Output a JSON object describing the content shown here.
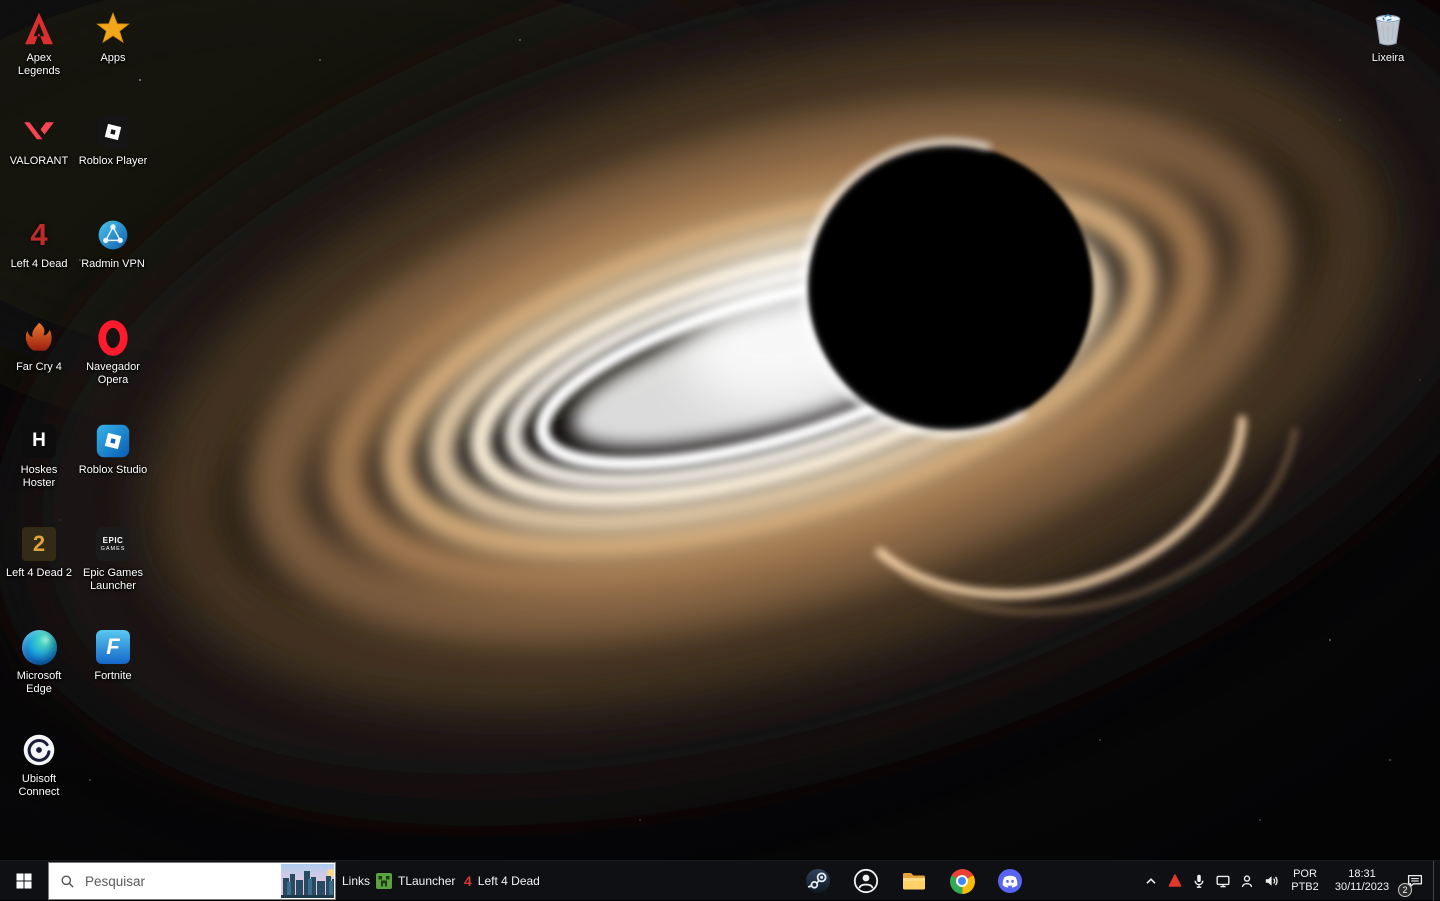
{
  "colors": {
    "taskbar_bg": "#101114",
    "search_bg": "#ffffff",
    "accretion_warm": "#e8c9a0",
    "discord_brand": "#5865f2",
    "opera_red": "#ff1b2d"
  },
  "desktop": {
    "icons": [
      {
        "label": "Apex Legends",
        "icon": "apex-legends-icon"
      },
      {
        "label": "VALORANT",
        "icon": "valorant-icon"
      },
      {
        "label": "Left 4 Dead",
        "icon": "left4dead-icon"
      },
      {
        "label": "Far Cry 4",
        "icon": "farcry4-icon"
      },
      {
        "label": "Hoskes Hoster",
        "icon": "hoskes-hoster-icon"
      },
      {
        "label": "Left 4 Dead 2",
        "icon": "left4dead2-icon"
      },
      {
        "label": "Microsoft Edge",
        "icon": "edge-icon"
      },
      {
        "label": "Ubisoft Connect",
        "icon": "ubisoft-connect-icon"
      },
      {
        "label": "Apps",
        "icon": "apps-star-icon"
      },
      {
        "label": "Roblox Player",
        "icon": "roblox-player-icon"
      },
      {
        "label": "Radmin VPN",
        "icon": "radmin-vpn-icon"
      },
      {
        "label": "Navegador Opera",
        "icon": "opera-icon"
      },
      {
        "label": "Roblox Studio",
        "icon": "roblox-studio-icon"
      },
      {
        "label": "Epic Games Launcher",
        "icon": "epic-games-icon"
      },
      {
        "label": "Fortnite",
        "icon": "fortnite-icon"
      }
    ],
    "glyphs": {
      "hoskes": "H",
      "left4dead": "4",
      "left4dead2": "2",
      "fortnite": "F",
      "epic_line1": "EPIC",
      "epic_line2": "GAMES"
    },
    "recycle_bin_label": "Lixeira"
  },
  "taskbar": {
    "search_placeholder": "Pesquisar",
    "links_label": "Links",
    "toolbar_items": [
      {
        "label": "TLauncher",
        "icon": "tlauncher-icon"
      },
      {
        "label": "Left 4 Dead",
        "icon": "left4dead-icon"
      }
    ],
    "pinned_icons": [
      "steam-icon",
      "user-circle-icon",
      "file-explorer-icon",
      "chrome-icon",
      "discord-icon"
    ],
    "tray_icons": [
      "chevron-up-icon",
      "red-app-icon",
      "microphone-icon",
      "display-icon",
      "remote-user-icon",
      "volume-icon"
    ],
    "tray": {
      "language": "POR",
      "keyboard_layout": "PTB2",
      "time": "18:31",
      "date": "30/11/2023",
      "notification_count": "2"
    }
  }
}
